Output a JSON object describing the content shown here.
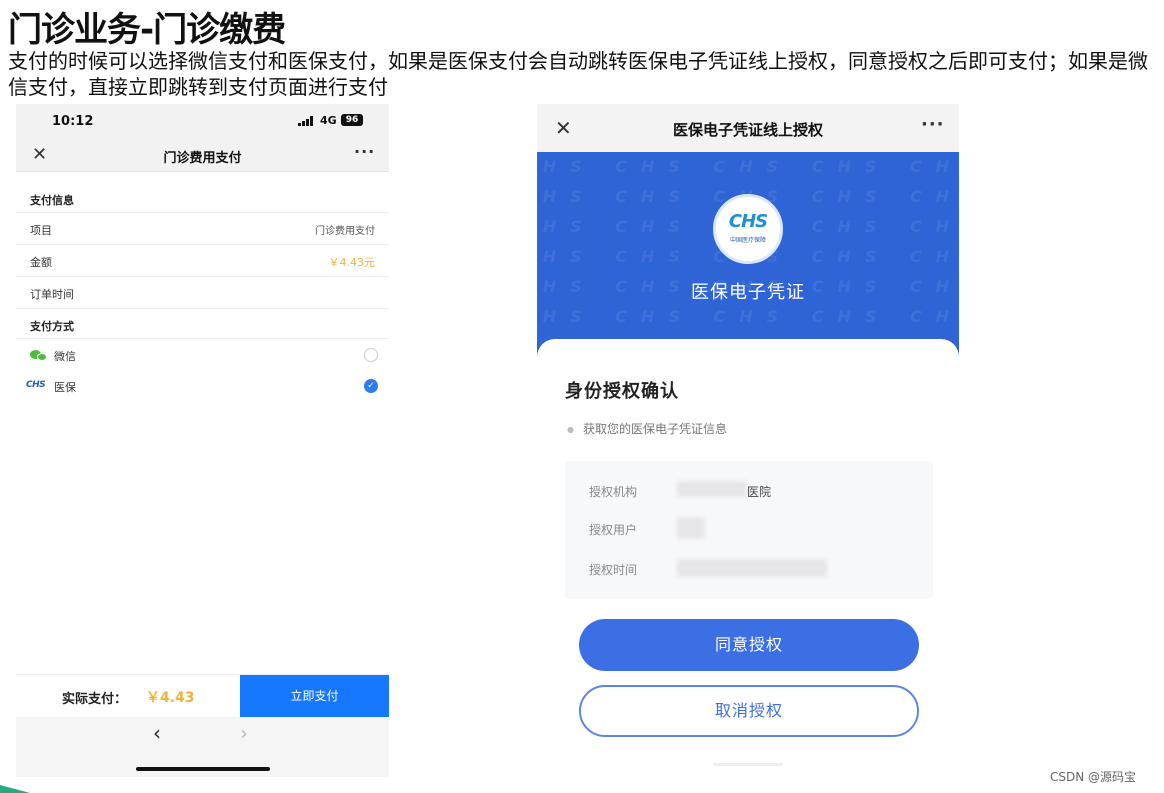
{
  "slide": {
    "title": "门诊业务-门诊缴费",
    "description": "支付的时候可以选择微信支付和医保支付，如果是医保支付会自动跳转医保电子凭证线上授权，同意授权之后即可支付；如果是微信支付，直接立即跳转到支付页面进行支付"
  },
  "left_phone": {
    "status": {
      "time": "10:12",
      "network": "4G",
      "battery": "96"
    },
    "nav": {
      "title": "门诊费用支付",
      "close_icon": "close-icon",
      "more_icon": "more-icon"
    },
    "payment_info": {
      "section_title": "支付信息",
      "rows": [
        {
          "label": "项目",
          "value": "门诊费用支付"
        },
        {
          "label": "金额",
          "value": "￥4.43元"
        },
        {
          "label": "订单时间",
          "value": ""
        }
      ]
    },
    "payment_method": {
      "section_title": "支付方式",
      "options": [
        {
          "label": "微信",
          "icon": "wechat-icon",
          "selected": false
        },
        {
          "label": "医保",
          "icon": "chs-logo-icon",
          "icon_text": "CHS",
          "selected": true
        }
      ]
    },
    "footer": {
      "total_label": "实际支付：",
      "total_amount": "￥4.43",
      "pay_button": "立即支付"
    },
    "browser": {
      "back": "‹",
      "forward": "›"
    },
    "colors": {
      "accent": "#1677ff",
      "amount": "#f2b33a",
      "wechat": "#4cbf3a"
    }
  },
  "right_phone": {
    "nav": {
      "title": "医保电子凭证线上授权",
      "close_icon": "close-icon",
      "more_icon": "more-icon"
    },
    "banner": {
      "logo_text": "CHS",
      "logo_subtext": "中国医疗保障",
      "title": "医保电子凭证",
      "watermark": "CHS"
    },
    "card": {
      "heading": "身份授权确认",
      "scope": "获取您的医保电子凭证信息",
      "fields": [
        {
          "label": "授权机构",
          "value": "医院"
        },
        {
          "label": "授权用户",
          "value": ""
        },
        {
          "label": "授权时间",
          "value": ""
        }
      ],
      "agree_button": "同意授权",
      "cancel_button": "取消授权"
    },
    "colors": {
      "banner": "#2f64d6",
      "button": "#3c6fe3"
    }
  },
  "footer": {
    "credit": "CSDN @源码宝"
  }
}
